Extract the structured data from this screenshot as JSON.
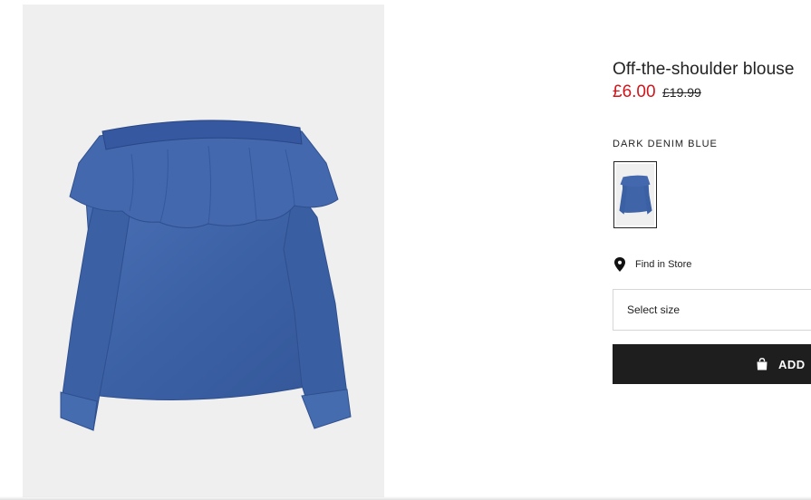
{
  "product": {
    "title": "Off-the-shoulder blouse",
    "price_sale": "£6.00",
    "price_original": "£19.99",
    "color_name": "DARK DENIM BLUE",
    "find_in_store": "Find in Store",
    "size_placeholder": "Select size",
    "add_label": "ADD"
  },
  "colors": {
    "sale_price": "#d0161c",
    "button_bg": "#1e1e1e",
    "denim": "#3f64a8",
    "image_bg": "#efefef"
  },
  "icons": {
    "store": "location-pin-icon",
    "bag": "shopping-bag-icon"
  }
}
